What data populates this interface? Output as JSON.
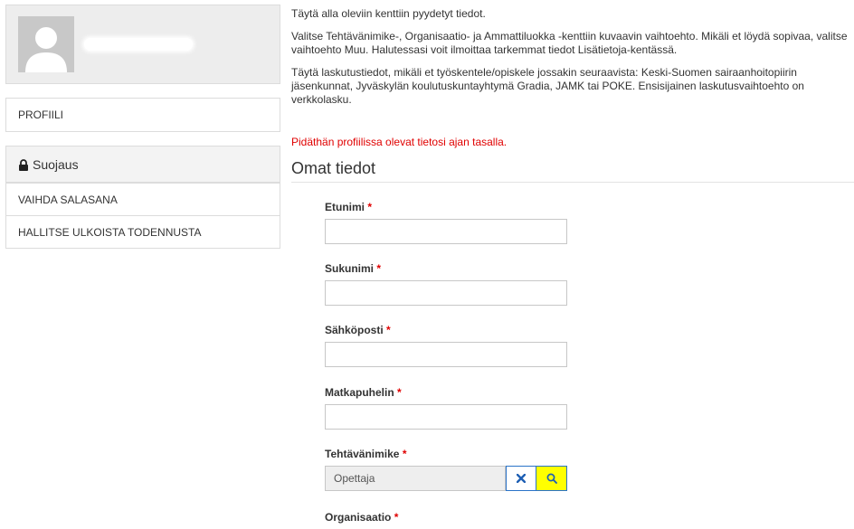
{
  "sidebar": {
    "menu_profile": "PROFIILI",
    "security_header": "Suojaus",
    "security_items": [
      "VAIHDA SALASANA",
      "HALLITSE ULKOISTA TODENNUSTA"
    ]
  },
  "intro": {
    "p1": "Täytä alla oleviin kenttiin pyydetyt tiedot.",
    "p2": "Valitse Tehtävänimike-, Organisaatio- ja Ammattiluokka -kenttiin kuvaavin vaihtoehto. Mikäli et löydä sopivaa, valitse vaihtoehto Muu. Halutessasi voit ilmoittaa tarkemmat tiedot Lisätietoja-kentässä.",
    "p3": "Täytä laskutustiedot, mikäli et työskentele/opiskele jossakin seuraavista: Keski-Suomen sairaanhoitopiirin jäsenkunnat, Jyväskylän koulutuskuntayhtymä Gradia, JAMK tai POKE. Ensisijainen laskutusvaihtoehto on verkkolasku.",
    "warning": "Pidäthän profiilissa olevat tietosi ajan tasalla."
  },
  "form": {
    "title": "Omat tiedot",
    "required_mark": "*",
    "fields": {
      "first_name": {
        "label": "Etunimi",
        "value": ""
      },
      "last_name": {
        "label": "Sukunimi",
        "value": ""
      },
      "email": {
        "label": "Sähköposti",
        "value": ""
      },
      "phone": {
        "label": "Matkapuhelin",
        "value": ""
      },
      "job_title": {
        "label": "Tehtävänimike",
        "value": "Opettaja"
      },
      "organization": {
        "label": "Organisaatio"
      }
    }
  },
  "colors": {
    "required": "#e00000",
    "search_button": "#ffff00",
    "lookup_border": "#2a73c8"
  }
}
